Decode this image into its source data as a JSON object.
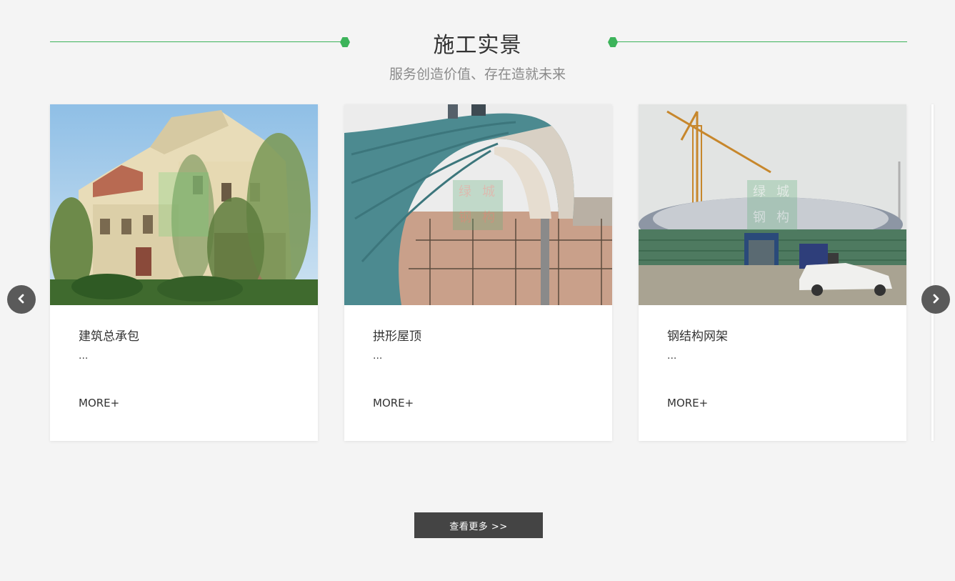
{
  "section": {
    "title": "施工实景",
    "subtitle": "服务创造价值、存在造就未来"
  },
  "cards": [
    {
      "title": "建筑总承包",
      "desc": "...",
      "more": "MORE+",
      "image": "villa-photo"
    },
    {
      "title": "拱形屋顶",
      "desc": "...",
      "more": "MORE+",
      "image": "arched-roof-photo"
    },
    {
      "title": "钢结构网架",
      "desc": "...",
      "more": "MORE+",
      "image": "stadium-construction-photo"
    }
  ],
  "watermark": [
    "绿",
    "城",
    "钢",
    "构"
  ],
  "nav": {
    "prev_icon": "chevron-left-icon",
    "next_icon": "chevron-right-icon"
  },
  "view_more_label": "查看更多 >>",
  "colors": {
    "accent": "#3cb35a",
    "button": "#444444",
    "background": "#f4f4f4"
  }
}
